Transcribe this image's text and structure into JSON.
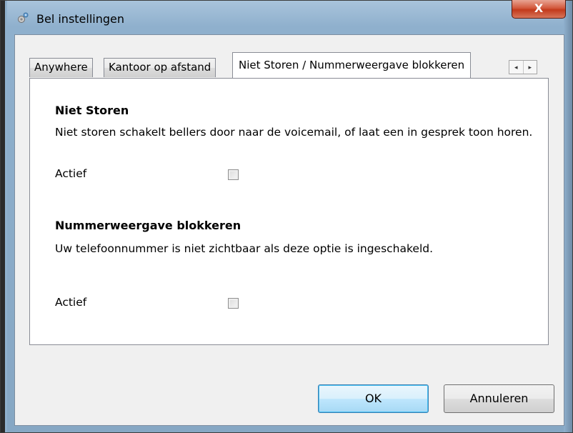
{
  "window": {
    "title": "Bel instellingen",
    "close_label": "X",
    "title_icon": "gear-icon"
  },
  "tabs": [
    {
      "label": "Anywhere",
      "active": false
    },
    {
      "label": "Kantoor op afstand",
      "active": false
    },
    {
      "label": "Niet Storen / Nummerweergave blokkeren",
      "active": true
    }
  ],
  "tab_scroll": {
    "left": "◂",
    "right": "▸"
  },
  "dnd": {
    "heading": "Niet Storen",
    "description": "Niet storen schakelt bellers door naar de voicemail, of laat een in gesprek toon horen.",
    "active_label": "Actief",
    "checked": false
  },
  "block": {
    "heading": "Nummerweergave blokkeren",
    "description": "Uw telefoonnummer is niet zichtbaar als deze optie is ingeschakeld.",
    "active_label": "Actief",
    "checked": false
  },
  "buttons": {
    "ok": "OK",
    "cancel": "Annuleren"
  }
}
